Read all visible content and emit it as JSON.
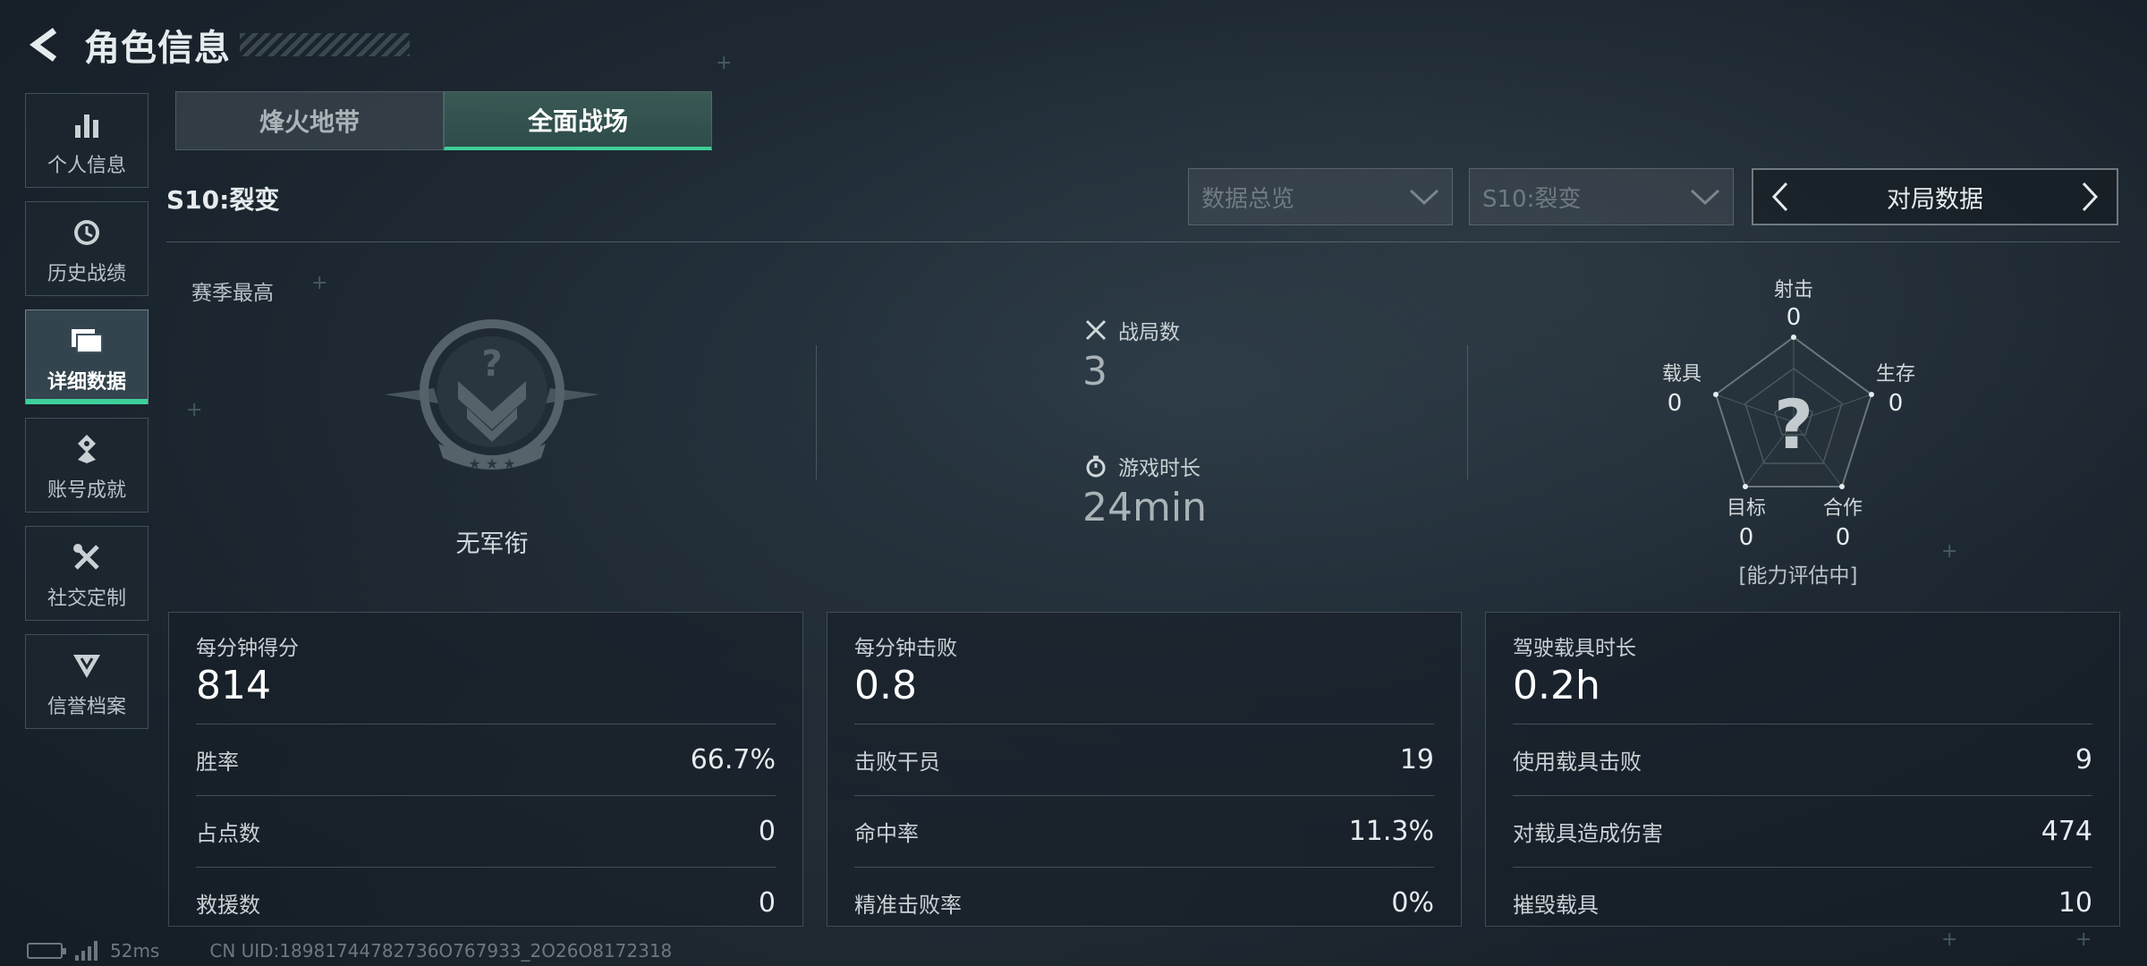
{
  "header": {
    "title": "角色信息"
  },
  "sidebar": {
    "items": [
      {
        "label": "个人信息",
        "icon": "bar-chart-icon"
      },
      {
        "label": "历史战绩",
        "icon": "clock-history-icon"
      },
      {
        "label": "详细数据",
        "icon": "folder-data-icon",
        "active": true
      },
      {
        "label": "账号成就",
        "icon": "achievement-icon"
      },
      {
        "label": "社交定制",
        "icon": "tools-icon"
      },
      {
        "label": "信誉档案",
        "icon": "shield-badge-icon"
      }
    ]
  },
  "mode_tabs": [
    {
      "label": "烽火地带",
      "active": false
    },
    {
      "label": "全面战场",
      "active": true
    }
  ],
  "filters": {
    "season_label": "S10:裂变",
    "dropdown_overview": "数据总览",
    "dropdown_season": "S10:裂变",
    "pager_label": "对局数据"
  },
  "summary": {
    "season_best_label": "赛季最高",
    "rank_name": "无军衔",
    "matches_label": "战局数",
    "matches_value": "3",
    "playtime_label": "游戏时长",
    "playtime_value": "24min"
  },
  "radar": {
    "axes": [
      {
        "label": "射击",
        "value": "0"
      },
      {
        "label": "生存",
        "value": "0"
      },
      {
        "label": "合作",
        "value": "0"
      },
      {
        "label": "目标",
        "value": "0"
      },
      {
        "label": "载具",
        "value": "0"
      }
    ],
    "status": "[能力评估中]",
    "center_glyph": "?"
  },
  "panels": [
    {
      "title": "每分钟得分",
      "value": "814",
      "rows": [
        {
          "key": "胜率",
          "value": "66.7%"
        },
        {
          "key": "占点数",
          "value": "0"
        },
        {
          "key": "救援数",
          "value": "0"
        }
      ]
    },
    {
      "title": "每分钟击败",
      "value": "0.8",
      "rows": [
        {
          "key": "击败干员",
          "value": "19"
        },
        {
          "key": "命中率",
          "value": "11.3%"
        },
        {
          "key": "精准击败率",
          "value": "0%"
        }
      ]
    },
    {
      "title": "驾驶载具时长",
      "value": "0.2h",
      "rows": [
        {
          "key": "使用载具击败",
          "value": "9"
        },
        {
          "key": "对载具造成伤害",
          "value": "474"
        },
        {
          "key": "摧毁载具",
          "value": "10"
        }
      ]
    }
  ],
  "footer": {
    "ping": "52ms",
    "uid": "CN UID:18981744782736O767933_2O26O8172318"
  },
  "colors": {
    "accent": "#3ecf9a",
    "background": "#1e2933"
  }
}
